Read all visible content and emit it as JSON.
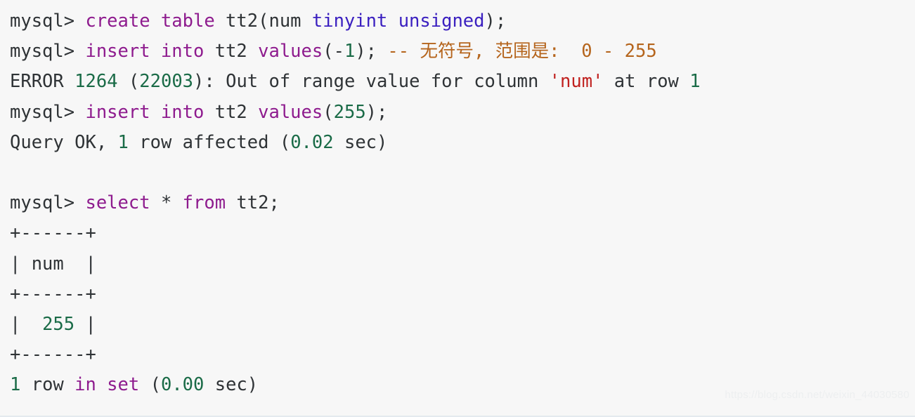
{
  "terminal": {
    "background_color": "#f7f7f7",
    "colors": {
      "plain": "#2f3336",
      "keyword": "#8e1b8e",
      "type": "#3b20c0",
      "number": "#1a6b47",
      "string": "#c0211f",
      "comment": "#b5651d",
      "watermark": "#edeff0"
    },
    "lines": [
      {
        "id": "line-1-create-table",
        "segments": [
          {
            "text": "mysql> ",
            "cls": "plain"
          },
          {
            "text": "create table",
            "cls": "kw"
          },
          {
            "text": " tt2(num ",
            "cls": "plain"
          },
          {
            "text": "tinyint unsigned",
            "cls": "type"
          },
          {
            "text": ");",
            "cls": "plain"
          }
        ]
      },
      {
        "id": "line-2-insert-negative",
        "segments": [
          {
            "text": "mysql> ",
            "cls": "plain"
          },
          {
            "text": "insert into",
            "cls": "kw"
          },
          {
            "text": " tt2 ",
            "cls": "plain"
          },
          {
            "text": "values",
            "cls": "kw"
          },
          {
            "text": "(-",
            "cls": "plain"
          },
          {
            "text": "1",
            "cls": "num"
          },
          {
            "text": "); ",
            "cls": "plain"
          },
          {
            "text": "-- 无符号, 范围是:  0 - 255",
            "cls": "comment"
          }
        ]
      },
      {
        "id": "line-3-error",
        "segments": [
          {
            "text": "ERROR ",
            "cls": "plain"
          },
          {
            "text": "1264",
            "cls": "num"
          },
          {
            "text": " (",
            "cls": "plain"
          },
          {
            "text": "22003",
            "cls": "num"
          },
          {
            "text": "): Out of range value for column ",
            "cls": "plain"
          },
          {
            "text": "'num'",
            "cls": "str"
          },
          {
            "text": " at row ",
            "cls": "plain"
          },
          {
            "text": "1",
            "cls": "num"
          }
        ]
      },
      {
        "id": "line-4-insert-255",
        "segments": [
          {
            "text": "mysql> ",
            "cls": "plain"
          },
          {
            "text": "insert into",
            "cls": "kw"
          },
          {
            "text": " tt2 ",
            "cls": "plain"
          },
          {
            "text": "values",
            "cls": "kw"
          },
          {
            "text": "(",
            "cls": "plain"
          },
          {
            "text": "255",
            "cls": "num"
          },
          {
            "text": ");",
            "cls": "plain"
          }
        ]
      },
      {
        "id": "line-5-query-ok",
        "segments": [
          {
            "text": "Query OK, ",
            "cls": "plain"
          },
          {
            "text": "1",
            "cls": "num"
          },
          {
            "text": " row affected (",
            "cls": "plain"
          },
          {
            "text": "0.02",
            "cls": "num"
          },
          {
            "text": " sec)",
            "cls": "plain"
          }
        ]
      },
      {
        "id": "line-6-blank",
        "segments": [
          {
            "text": " ",
            "cls": "plain"
          }
        ]
      },
      {
        "id": "line-7-select",
        "segments": [
          {
            "text": "mysql> ",
            "cls": "plain"
          },
          {
            "text": "select",
            "cls": "kw"
          },
          {
            "text": " * ",
            "cls": "plain"
          },
          {
            "text": "from",
            "cls": "kw"
          },
          {
            "text": " tt2;",
            "cls": "plain"
          }
        ]
      },
      {
        "id": "line-8-separator-top",
        "segments": [
          {
            "text": "+------+",
            "cls": "plain"
          }
        ]
      },
      {
        "id": "line-9-header",
        "segments": [
          {
            "text": "| num  |",
            "cls": "plain"
          }
        ]
      },
      {
        "id": "line-10-separator-mid",
        "segments": [
          {
            "text": "+------+",
            "cls": "plain"
          }
        ]
      },
      {
        "id": "line-11-row-255",
        "segments": [
          {
            "text": "|  ",
            "cls": "plain"
          },
          {
            "text": "255",
            "cls": "num"
          },
          {
            "text": " |",
            "cls": "plain"
          }
        ]
      },
      {
        "id": "line-12-separator-bottom",
        "segments": [
          {
            "text": "+------+",
            "cls": "plain"
          }
        ]
      },
      {
        "id": "line-13-row-in-set",
        "segments": [
          {
            "text": "1",
            "cls": "num"
          },
          {
            "text": " row ",
            "cls": "plain"
          },
          {
            "text": "in set",
            "cls": "kw"
          },
          {
            "text": " (",
            "cls": "plain"
          },
          {
            "text": "0.00",
            "cls": "num"
          },
          {
            "text": " sec)",
            "cls": "plain"
          }
        ]
      }
    ]
  },
  "watermark": {
    "text": "https://blog.csdn.net/weixin_44030580"
  }
}
